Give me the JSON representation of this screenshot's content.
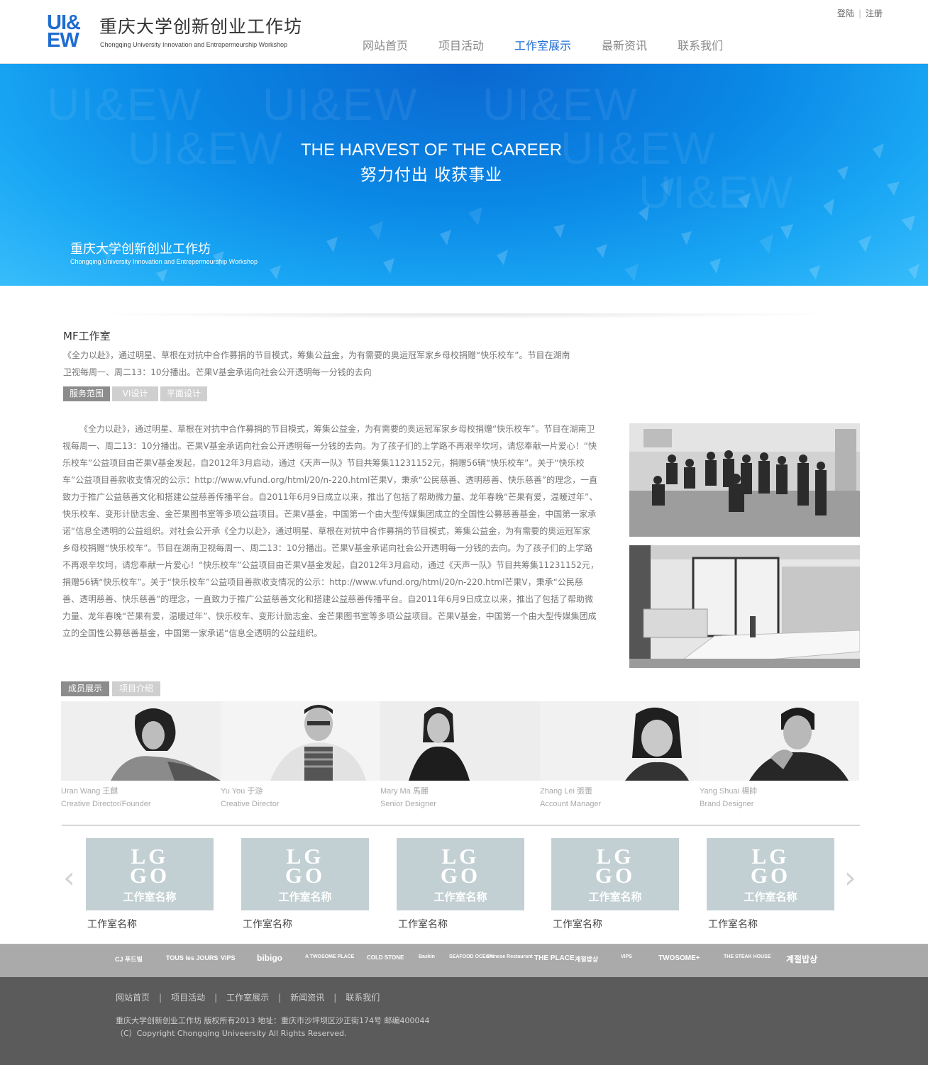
{
  "header": {
    "logo_mark_line1": "UI&",
    "logo_mark_line2": "EW",
    "site_title": "重庆大学创新创业工作坊",
    "site_subtitle": "Chongqing University Innovation and Entrepermeurship Workshop",
    "auth": {
      "login": "登陆",
      "separator": "|",
      "register": "注册"
    },
    "nav": [
      {
        "label": "网站首页",
        "active": false
      },
      {
        "label": "项目活动",
        "active": false
      },
      {
        "label": "工作室展示",
        "active": true
      },
      {
        "label": "最新资讯",
        "active": false
      },
      {
        "label": "联系我们",
        "active": false
      }
    ],
    "accent_color": "#1e6cd1"
  },
  "banner": {
    "title_en": "THE HARVEST OF THE CAREER",
    "title_cn": "努力付出 收获事业",
    "brand_cn": "重庆大学创新创业工作坊",
    "brand_en": "Chongqing University Innovation and Entrepermeurship Workshop",
    "watermark": "UI&EW"
  },
  "studio": {
    "title": "MF工作室",
    "intro": "《全力以赴》，通过明星、草根在对抗中合作募捐的节目模式，筹集公益金，为有需要的奥运冠军家乡母校捐赠“快乐校车”。节目在湖南卫视每周一、周二13：10分播出。芒果V基金承诺向社会公开透明每一分钱的去向",
    "tabs": [
      {
        "label": "服务范围",
        "active": true
      },
      {
        "label": "VI设计",
        "active": false
      },
      {
        "label": "平面设计",
        "active": false
      }
    ],
    "article": "《全力以赴》，通过明星、草根在对抗中合作募捐的节目模式，筹集公益金，为有需要的奥运冠军家乡母校捐赠“快乐校车”。节目在湖南卫视每周一、周二13：10分播出。芒果V基金承诺向社会公开透明每一分钱的去向。为了孩子们的上学路不再艰辛坎坷，请您奉献一片爱心！“快乐校车”公益项目由芒果V基金发起，自2012年3月启动，通过《天声一队》节目共筹集11231152元，捐赠56辆“快乐校车”。关于“快乐校车”公益项目善款收支情况的公示：http://www.vfund.org/html/20/n-220.html芒果V，秉承“公民慈善、透明慈善、快乐慈善”的理念，一直致力于推广公益慈善文化和搭建公益慈善传播平台。自2011年6月9日成立以来，推出了包括了帮助微力量、龙年春晚“芒果有爱，温暖过年”、快乐校车、变形计励志金、金芒果图书室等多项公益项目。芒果V基金，中国第一个由大型传媒集团成立的全国性公募慈善基金，中国第一家承诺“信息全透明的公益组织。对社会公开承《全力以赴》，通过明星、草根在对抗中合作募捐的节目模式，筹集公益金，为有需要的奥运冠军家乡母校捐赠“快乐校车”。节目在湖南卫视每周一、周二13：10分播出。芒果V基金承诺向社会公开透明每一分钱的去向。为了孩子们的上学路不再艰辛坎坷，请您奉献一片爱心！“快乐校车”公益项目由芒果V基金发起，自2012年3月启动，通过《天声一队》节目共筹集11231152元，捐赠56辆“快乐校车”。关于“快乐校车”公益项目善款收支情况的公示：http://www.vfund.org/html/20/n-220.html芒果V，秉承“公民慈善、透明慈善、快乐慈善”的理念，一直致力于推广公益慈善文化和搭建公益慈善传播平台。自2011年6月9日成立以来，推出了包括了帮助微力量、龙年春晚“芒果有爱，温暖过年”、快乐校车、变形计励志金、金芒果图书室等多项公益项目。芒果V基金，中国第一个由大型传媒集团成立的全国性公募慈善基金，中国第一家承诺“信息全透明的公益组织。"
  },
  "members_section": {
    "tabs": [
      {
        "label": "成员展示",
        "active": true
      },
      {
        "label": "项目介绍",
        "active": false
      }
    ],
    "members": [
      {
        "name": "Uran Wang 王麒",
        "role": "Creative Director/Founder"
      },
      {
        "name": "Yu You 于游",
        "role": "Creative Director"
      },
      {
        "name": "Mary Ma 馬麗",
        "role": "Senior Designer"
      },
      {
        "name": "Zhang Lei 張蕾",
        "role": "Account Manager"
      },
      {
        "name": "Yang Shuai 楊帥",
        "role": "Brand Designer"
      }
    ]
  },
  "studios_carousel": {
    "prev_icon": "‹",
    "next_icon": "›",
    "card_logo_line1": "LG",
    "card_logo_line2": "GO",
    "card_text": "工作室名称",
    "items": [
      {
        "name": "工作室名称"
      },
      {
        "name": "工作室名称"
      },
      {
        "name": "工作室名称"
      },
      {
        "name": "工作室名称"
      },
      {
        "name": "工作室名称"
      }
    ]
  },
  "partners": [
    "CJ 푸드빌",
    "TOUS les JOURS",
    "VIPS",
    "bibigo",
    "A TWOSOME PLACE",
    "COLD STONE",
    "Baskin",
    "SEAFOOD OCEAN",
    "Chinese Restaurant",
    "THE PLACE",
    "계절밥상",
    "VIPS",
    "TWOSOME+",
    "THE STEAK HOUSE",
    "계절밥상"
  ],
  "footer": {
    "nav": [
      "网站首页",
      "项目活动",
      "工作室展示",
      "新闻资讯",
      "联系我们"
    ],
    "separator": "|",
    "copyright_line1": "重庆大学创新创业工作坊 版权所有2013  地址：重庆市沙坪坝区沙正街174号  邮编400044",
    "copyright_line2": "（C）Copyright Chongqing Univeersity All Rights Reserved."
  }
}
